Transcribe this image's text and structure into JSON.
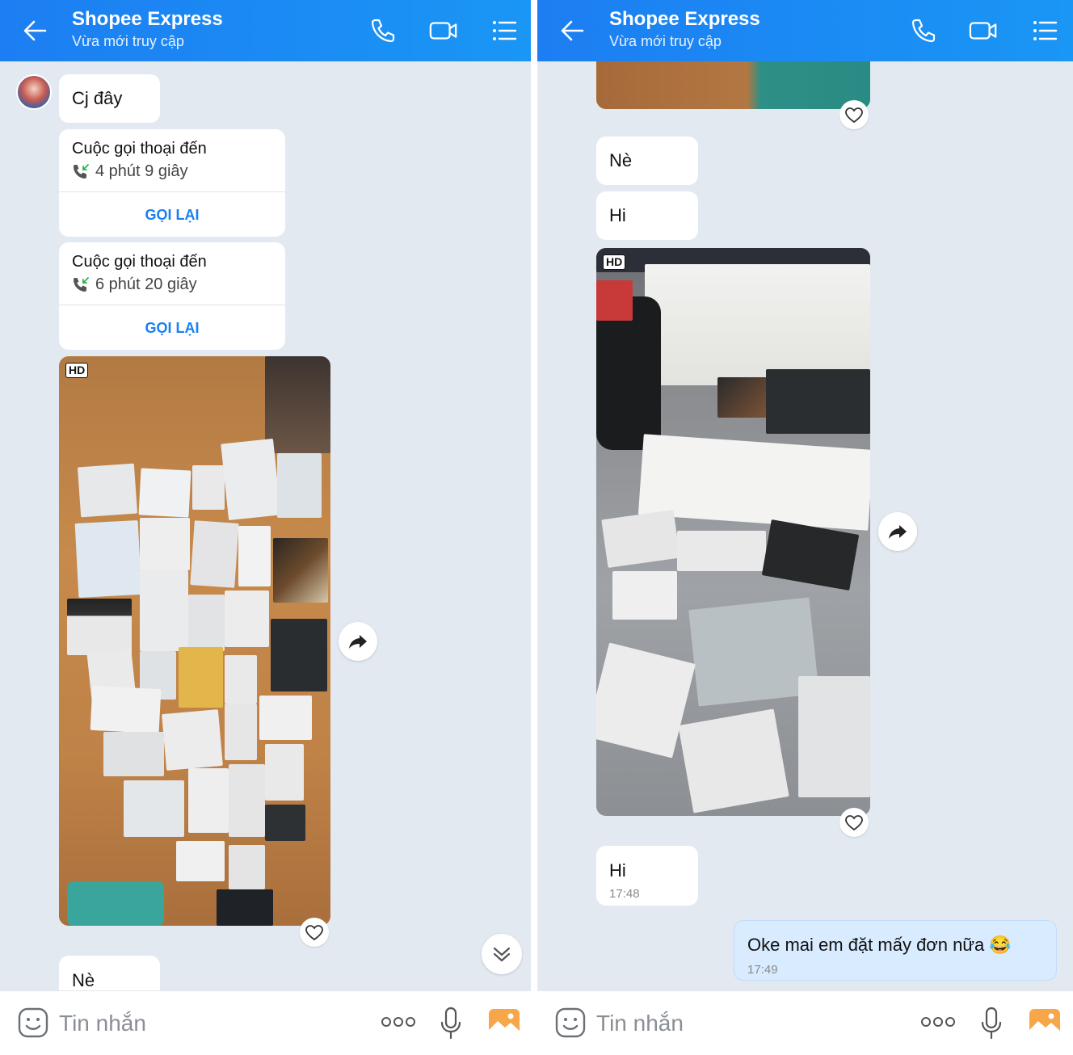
{
  "header": {
    "title": "Shopee Express",
    "subtitle": "Vừa mới truy cập"
  },
  "left": {
    "messages": {
      "m1": "Cj đây",
      "call1_title": "Cuộc gọi thoại đến",
      "call1_duration": "4 phút 9 giây",
      "call1_action": "GỌI LẠI",
      "call2_title": "Cuộc gọi thoại đến",
      "call2_duration": "6 phút 20 giây",
      "call2_action": "GỌI LẠI",
      "photo_badge": "HD",
      "m_last": "Nè"
    }
  },
  "right": {
    "messages": {
      "m1": "Nè",
      "m2": "Hi",
      "photo_badge": "HD",
      "m3": "Hi",
      "m3_time": "17:48",
      "m4": "Oke mai em đặt mấy đơn nữa 😂",
      "m4_time": "17:49"
    }
  },
  "composer": {
    "placeholder": "Tin nhắn"
  },
  "icons": {
    "header": [
      "back-arrow-icon",
      "phone-call-icon",
      "video-call-icon",
      "menu-list-icon"
    ],
    "composer": [
      "sticker-icon",
      "more-icon",
      "microphone-icon",
      "image-icon"
    ],
    "message": [
      "forward-icon",
      "heart-icon",
      "scroll-down-icon",
      "incoming-call-icon"
    ]
  },
  "colors": {
    "header_bg": "#1a8af3",
    "chat_bg": "#e3e9f1",
    "accent": "#1a7ff0",
    "my_bubble": "#d8ebff"
  }
}
